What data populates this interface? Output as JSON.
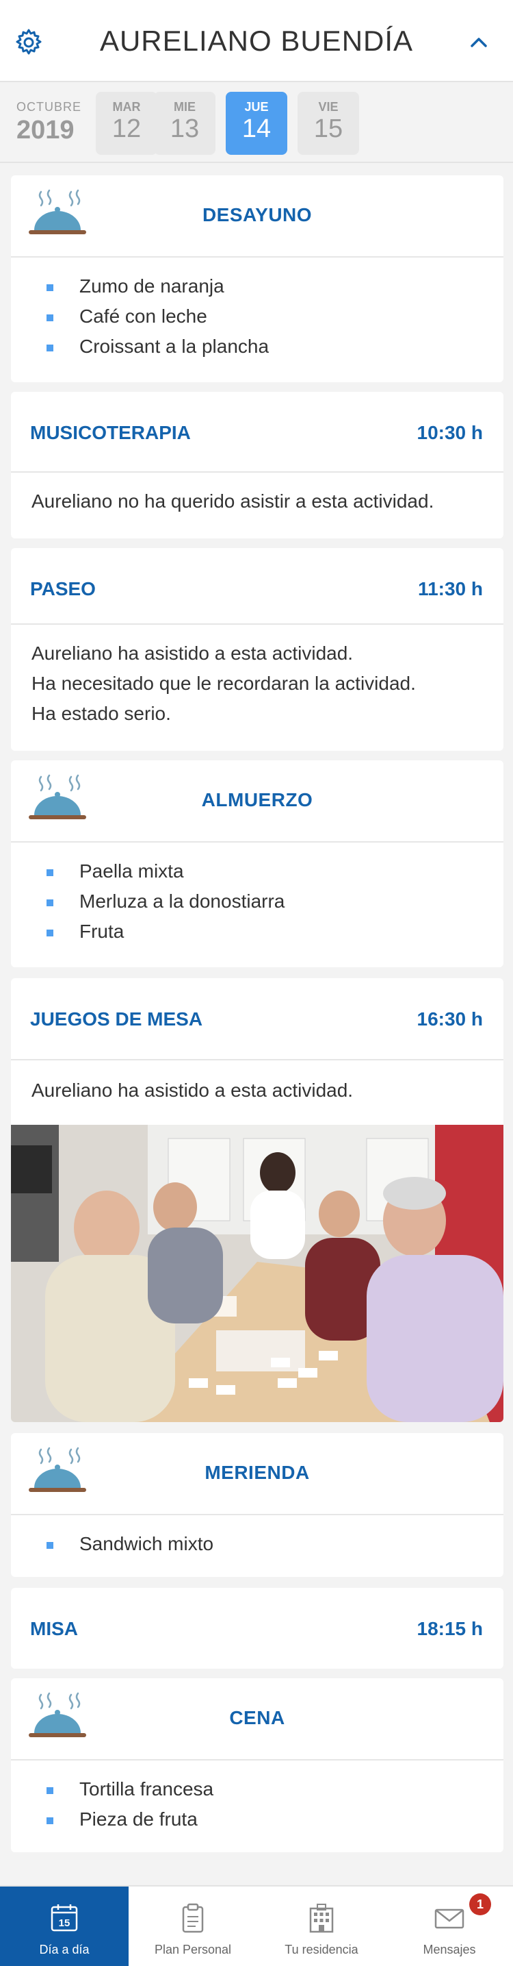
{
  "header": {
    "title": "AURELIANO BUENDÍA"
  },
  "datebar": {
    "month": "OCTUBRE",
    "year": "2019",
    "days": [
      {
        "name": "MAR",
        "num": "12"
      },
      {
        "name": "MIE",
        "num": "13"
      },
      {
        "name": "JUE",
        "num": "14",
        "selected": true
      },
      {
        "name": "VIE",
        "num": "15"
      }
    ]
  },
  "entries": {
    "desayuno": {
      "title": "DESAYUNO",
      "items": [
        "Zumo de naranja",
        "Café con leche",
        "Croissant a la plancha"
      ]
    },
    "musicoterapia": {
      "title": "MUSICOTERAPIA",
      "time": "10:30 h",
      "notes": [
        "Aureliano no ha querido asistir a esta actividad."
      ]
    },
    "paseo": {
      "title": "PASEO",
      "time": "11:30 h",
      "notes": [
        "Aureliano ha asistido a esta actividad.",
        "Ha necesitado que le recordaran la actividad.",
        "Ha estado serio."
      ]
    },
    "almuerzo": {
      "title": "ALMUERZO",
      "items": [
        "Paella mixta",
        "Merluza a la donostiarra",
        "Fruta"
      ]
    },
    "juegos": {
      "title": "JUEGOS DE MESA",
      "time": "16:30 h",
      "notes": [
        "Aureliano ha asistido a esta actividad."
      ]
    },
    "merienda": {
      "title": "MERIENDA",
      "items": [
        "Sandwich mixto"
      ]
    },
    "misa": {
      "title": "MISA",
      "time": "18:15 h"
    },
    "cena": {
      "title": "CENA",
      "items": [
        "Tortilla francesa",
        "Pieza de fruta"
      ]
    }
  },
  "tabbar": {
    "tabs": [
      {
        "label": "Día a día",
        "icon": "calendar-icon",
        "icon_text": "15",
        "active": true
      },
      {
        "label": "Plan Personal",
        "icon": "clipboard-icon"
      },
      {
        "label": "Tu residencia",
        "icon": "building-icon"
      },
      {
        "label": "Mensajes",
        "icon": "envelope-icon",
        "badge": "1"
      }
    ]
  },
  "colors": {
    "primary": "#1463ad",
    "accent": "#4f9ff0",
    "tabbar_active": "#0f5ba6",
    "badge": "#c62f24"
  }
}
